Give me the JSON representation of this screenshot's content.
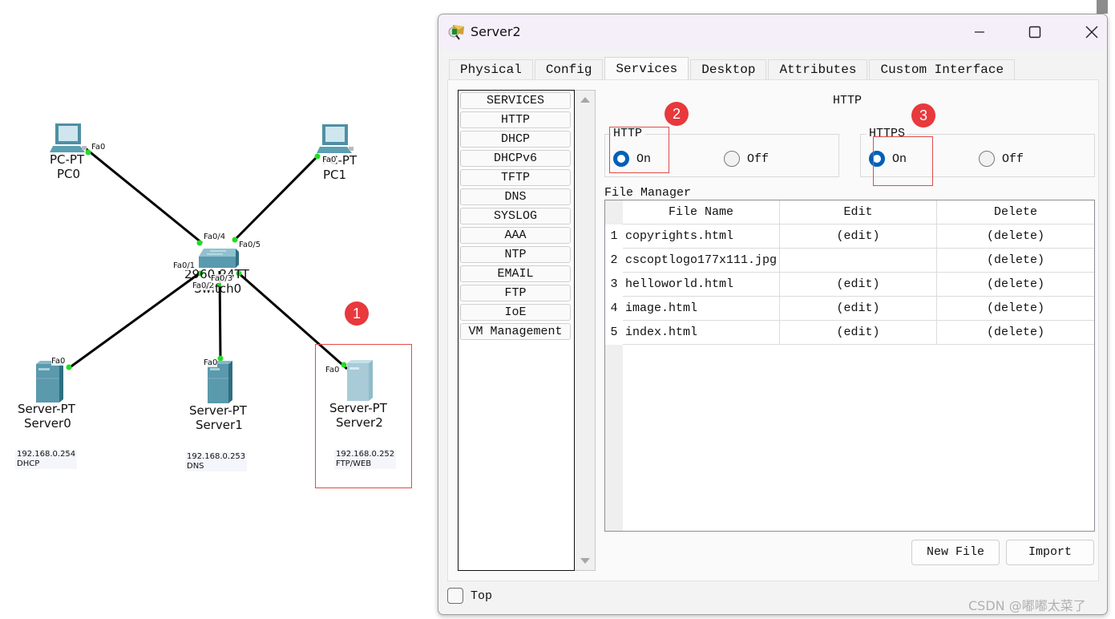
{
  "topology": {
    "devices": [
      {
        "id": "pc0",
        "model": "PC-PT",
        "name": "PC0",
        "port": "Fa0"
      },
      {
        "id": "pc1",
        "model": "PC-PT",
        "name": "PC1",
        "port": "Fa0"
      },
      {
        "id": "switch0",
        "model": "2960-24TT",
        "name": "Switch0",
        "ports": [
          "Fa0/4",
          "Fa0/5",
          "Fa0/1",
          "Fa0/2",
          "Fa0/3"
        ]
      },
      {
        "id": "server0",
        "model": "Server-PT",
        "name": "Server0",
        "port": "Fa0",
        "note_ip": "192.168.0.254",
        "note_role": "DHCP"
      },
      {
        "id": "server1",
        "model": "Server-PT",
        "name": "Server1",
        "port": "Fa0",
        "note_ip": "192.168.0.253",
        "note_role": "DNS"
      },
      {
        "id": "server2",
        "model": "Server-PT",
        "name": "Server2",
        "port": "Fa0",
        "note_ip": "192.168.0.252",
        "note_role": "FTP/WEB"
      }
    ],
    "annotations": [
      "1",
      "2",
      "3"
    ]
  },
  "window": {
    "title": "Server2",
    "controls": {
      "minimize": "minimize",
      "maximize": "maximize",
      "close": "close"
    },
    "tabs": [
      {
        "label": "Physical",
        "active": false
      },
      {
        "label": "Config",
        "active": false
      },
      {
        "label": "Services",
        "active": true
      },
      {
        "label": "Desktop",
        "active": false
      },
      {
        "label": "Attributes",
        "active": false
      },
      {
        "label": "Custom Interface",
        "active": false
      }
    ],
    "services": [
      "SERVICES",
      "HTTP",
      "DHCP",
      "DHCPv6",
      "TFTP",
      "DNS",
      "SYSLOG",
      "AAA",
      "NTP",
      "EMAIL",
      "FTP",
      "IoE",
      "VM Management"
    ],
    "panel_title": "HTTP",
    "http_group": {
      "legend": "HTTP",
      "on_label": "On",
      "off_label": "Off",
      "selected": "On"
    },
    "https_group": {
      "legend": "HTTPS",
      "on_label": "On",
      "off_label": "Off",
      "selected": "On"
    },
    "file_manager": {
      "label": "File Manager",
      "columns": [
        "File Name",
        "Edit",
        "Delete"
      ],
      "rows": [
        {
          "num": "1",
          "name": "copyrights.html",
          "edit": "(edit)",
          "delete": "(delete)"
        },
        {
          "num": "2",
          "name": "cscoptlogo177x111.jpg",
          "edit": "",
          "delete": "(delete)"
        },
        {
          "num": "3",
          "name": "helloworld.html",
          "edit": "(edit)",
          "delete": "(delete)"
        },
        {
          "num": "4",
          "name": "image.html",
          "edit": "(edit)",
          "delete": "(delete)"
        },
        {
          "num": "5",
          "name": "index.html",
          "edit": "(edit)",
          "delete": "(delete)"
        }
      ]
    },
    "buttons": {
      "new_file": "New File",
      "import": "Import"
    },
    "top_checkbox": {
      "label": "Top",
      "checked": false
    }
  },
  "watermark": "CSDN @嘟嘟太菜了",
  "colors": {
    "accent_radio": "#005fb8",
    "badge": "#e8393c",
    "highlight_box": "#e34a4a",
    "link_up": "#22dd22"
  }
}
